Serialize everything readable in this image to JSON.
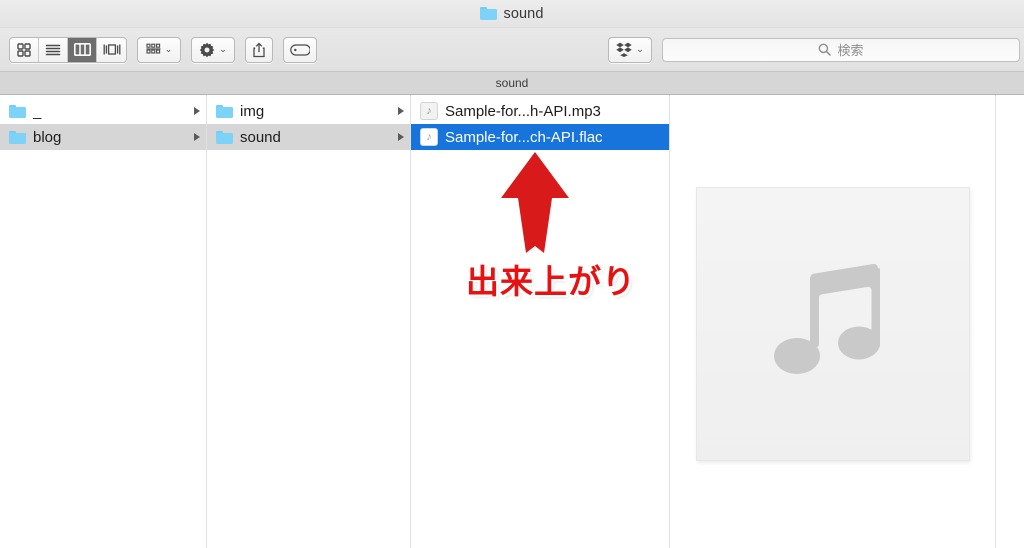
{
  "window": {
    "title": "sound",
    "title_icon": "folder-icon"
  },
  "pathbar": {
    "label": "sound"
  },
  "toolbar": {
    "view_modes": [
      {
        "name": "icon-view",
        "icon": "grid-icon",
        "active": false
      },
      {
        "name": "list-view",
        "icon": "list-icon",
        "active": false
      },
      {
        "name": "column-view",
        "icon": "columns-icon",
        "active": true
      },
      {
        "name": "coverflow-view",
        "icon": "coverflow-icon",
        "active": false
      }
    ],
    "arrange_button": {
      "icon": "arrange-icon",
      "chevron": "⌄"
    },
    "action_button": {
      "icon": "gear-icon",
      "chevron": "⌄"
    },
    "share_button": {
      "icon": "share-icon"
    },
    "tag_button": {
      "icon": "tag-icon"
    },
    "dropbox_button": {
      "icon": "dropbox-icon",
      "chevron": "⌄"
    },
    "search": {
      "icon": "search-icon",
      "placeholder": "検索",
      "value": ""
    }
  },
  "columns": [
    {
      "name": "column-1",
      "items": [
        {
          "label": "_",
          "type": "folder",
          "selected": false,
          "has_children": true
        },
        {
          "label": "blog",
          "type": "folder",
          "selected": true,
          "has_children": true
        }
      ]
    },
    {
      "name": "column-2",
      "items": [
        {
          "label": "img",
          "type": "folder",
          "selected": false,
          "has_children": true
        },
        {
          "label": "sound",
          "type": "folder",
          "selected": true,
          "has_children": true
        }
      ]
    },
    {
      "name": "column-3",
      "items": [
        {
          "label": "Sample-for...h-API.mp3",
          "type": "audio",
          "selected": false,
          "has_children": false
        },
        {
          "label": "Sample-for...ch-API.flac",
          "type": "audio",
          "selected": true,
          "has_children": false
        }
      ]
    }
  ],
  "preview": {
    "name": "preview-pane",
    "icon": "music-note-icon"
  },
  "annotation": {
    "text": "出来上がり",
    "arrow": "up-arrow",
    "color": "#e81111"
  },
  "colors": {
    "selection_blue": "#1874dd",
    "selection_gray": "#d6d6d6",
    "folder_blue": "#7dd2f7",
    "annotation_red": "#e81111"
  }
}
